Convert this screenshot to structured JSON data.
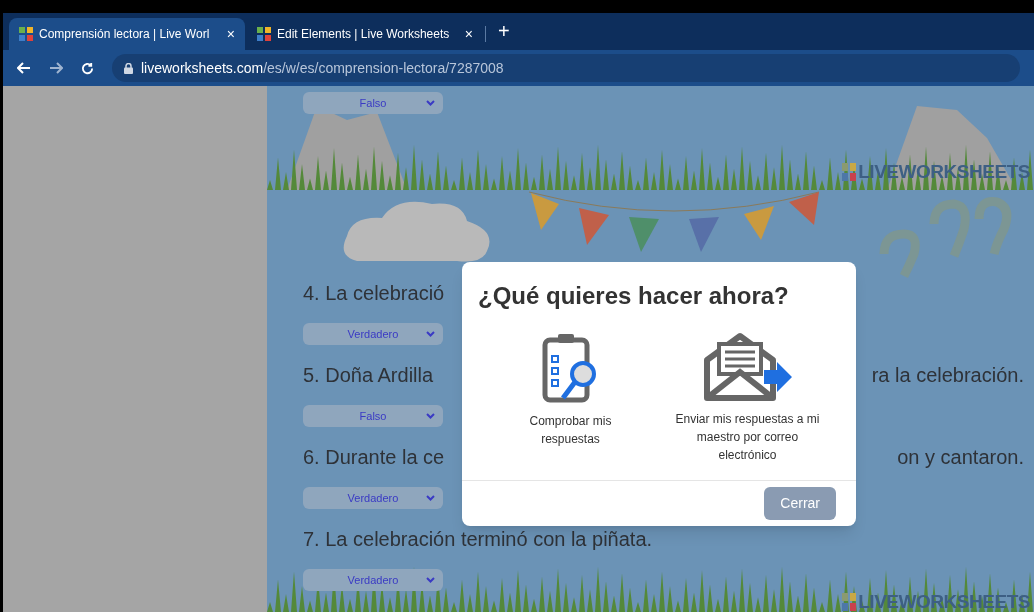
{
  "browser": {
    "tabs": [
      {
        "title": "Comprensión lectora | Live Worl",
        "close": "×",
        "selected": true
      },
      {
        "title": "Edit Elements | Live Worksheets",
        "close": "×",
        "selected": false
      }
    ],
    "new_tab": "+",
    "url_host": "liveworksheets.com",
    "url_path": "/es/w/es/comprension-lectora/7287008"
  },
  "worksheet": {
    "logo": "LIVEWORKSHEETS",
    "footer_logo": "LIVEWORKSHEETS",
    "top_dropdown": "Falso",
    "rows": [
      {
        "kind": "question",
        "left": "4. La celebració",
        "right": ""
      },
      {
        "kind": "dropdown",
        "value": "Verdadero"
      },
      {
        "kind": "question",
        "left": "5. Doña Ardilla",
        "right": "ra la celebración."
      },
      {
        "kind": "dropdown",
        "value": "Falso"
      },
      {
        "kind": "question",
        "left": "6. Durante la ce",
        "right": "on y cantaron."
      },
      {
        "kind": "dropdown",
        "value": "Verdadero"
      },
      {
        "kind": "question",
        "left": "7. La celebración terminó con la piñata.",
        "right": ""
      },
      {
        "kind": "dropdown",
        "value": "Verdadero"
      }
    ]
  },
  "dialog": {
    "title": "¿Qué quieres hacer ahora?",
    "options": [
      {
        "kind": "check",
        "label": "Comprobar mis respuestas"
      },
      {
        "kind": "email",
        "label": "Enviar mis respuestas a mi maestro por correo electrónico"
      }
    ],
    "close_button": "Cerrar"
  }
}
